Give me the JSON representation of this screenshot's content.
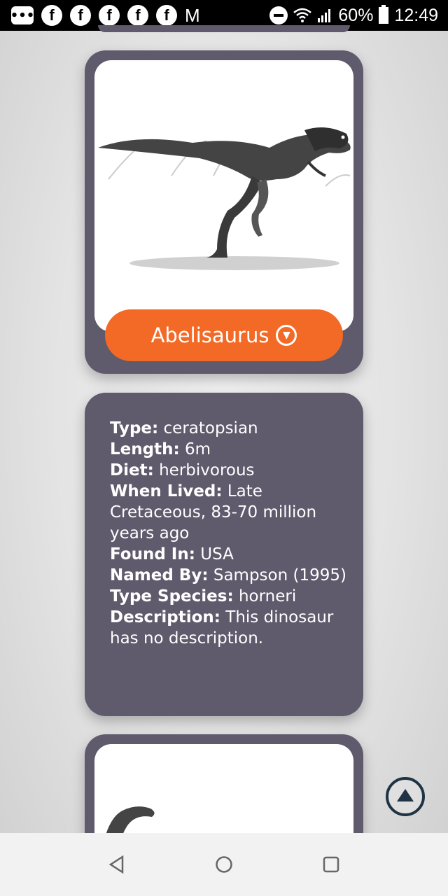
{
  "status_bar": {
    "battery": "60%",
    "time": "12:49",
    "notification_icons": [
      "messages-icon",
      "facebook-icon",
      "facebook-icon",
      "facebook-icon",
      "facebook-icon",
      "facebook-icon",
      "gmail-icon"
    ]
  },
  "dinosaur_card": {
    "name": "Abelisaurus",
    "image": "dinosaur-illustration"
  },
  "info": {
    "type_label": "Type:",
    "type_value": "ceratopsian",
    "length_label": "Length:",
    "length_value": "6m",
    "diet_label": "Diet:",
    "diet_value": "herbivorous",
    "when_label": "When Lived:",
    "when_value": "Late Cretaceous, 83-70 million years ago",
    "found_label": "Found In:",
    "found_value": "USA",
    "named_label": "Named By:",
    "named_value": "Sampson (1995)",
    "species_label": "Type Species:",
    "species_value": "horneri",
    "desc_label": "Description:",
    "desc_value": "This dinosaur has no description."
  },
  "colors": {
    "card_bg": "#5f5a6c",
    "accent": "#f26a26",
    "fab": "#1f3344"
  }
}
